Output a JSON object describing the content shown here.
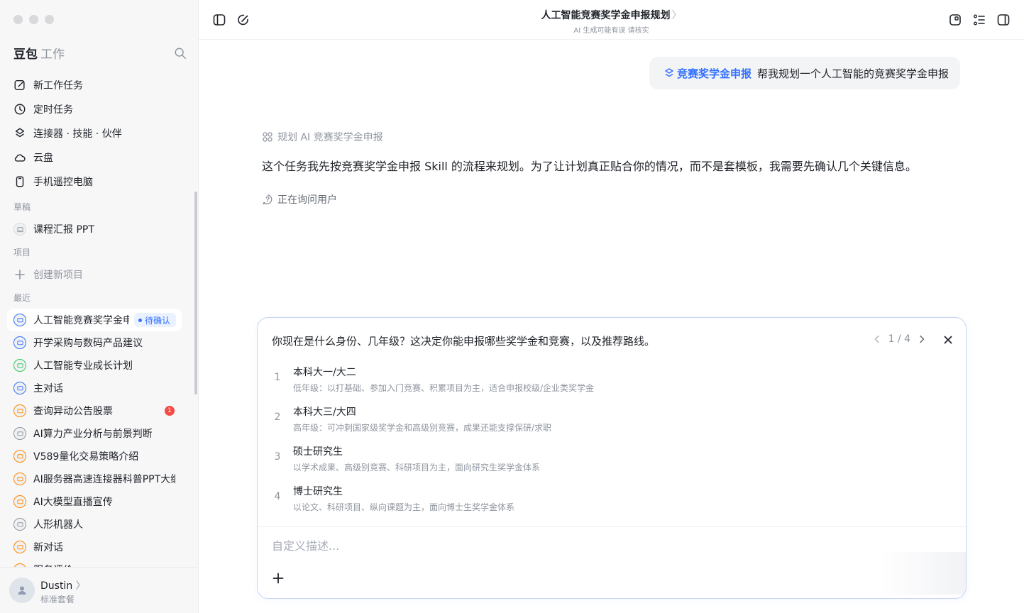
{
  "sidebar": {
    "brand": "豆包",
    "brand_sub": "工作",
    "nav": [
      {
        "label": "新工作任务",
        "icon": "edit-icon"
      },
      {
        "label": "定时任务",
        "icon": "clock-icon"
      },
      {
        "label": "连接器 · 技能 · 伙伴",
        "icon": "layers-icon"
      },
      {
        "label": "云盘",
        "icon": "cloud-icon"
      },
      {
        "label": "手机遥控电脑",
        "icon": "phone-icon"
      }
    ],
    "drafts_label": "草稿",
    "drafts": [
      {
        "label": "课程汇报 PPT"
      }
    ],
    "projects_label": "项目",
    "create_project": "创建新项目",
    "recent_label": "最近",
    "recent": [
      {
        "label": "人工智能竞赛奖学金申报规划",
        "badge": "待确认",
        "color": "#3370ff"
      },
      {
        "label": "开学采购与数码产品建议",
        "color": "#3370ff"
      },
      {
        "label": "人工智能专业成长计划",
        "color": "#34c759"
      },
      {
        "label": "主对话",
        "color": "#3370ff"
      },
      {
        "label": "查询异动公告股票",
        "count": "1",
        "color": "#ff8800"
      },
      {
        "label": "AI算力产业分析与前景判断",
        "color": "#8f959e"
      },
      {
        "label": "V589量化交易策略介绍",
        "color": "#ff8800"
      },
      {
        "label": "AI服务器高速连接器科普PPT大纲",
        "color": "#ff8800"
      },
      {
        "label": "AI大模型直播宣传",
        "color": "#ff8800"
      },
      {
        "label": "人形机器人",
        "color": "#8f959e"
      },
      {
        "label": "新对话",
        "color": "#ff8800"
      },
      {
        "label": "服务评价",
        "color": "#ff8800"
      }
    ],
    "user": {
      "name": "Dustin",
      "plan": "标准套餐"
    }
  },
  "header": {
    "title": "人工智能竞赛奖学金申报规划",
    "subtitle": "AI 生成可能有误 请核实"
  },
  "conversation": {
    "skill_tag": "竞赛奖学金申报",
    "user_message": "帮我规划一个人工智能的竞赛奖学金申报",
    "step_label": "规划 AI 竞赛奖学金申报",
    "answer": "这个任务我先按竞赛奖学金申报 Skill 的流程来规划。为了让计划真正贴合你的情况，而不是套模板，我需要先确认几个关键信息。",
    "status": "正在询问用户"
  },
  "question_card": {
    "question": "你现在是什么身份、几年级？这决定你能申报哪些奖学金和竞赛，以及推荐路线。",
    "pager": "1 / 4",
    "options": [
      {
        "num": "1",
        "title": "本科大一/大二",
        "desc": "低年级：以打基础、参加入门竞赛、积累项目为主，适合申报校级/企业类奖学金"
      },
      {
        "num": "2",
        "title": "本科大三/大四",
        "desc": "高年级：可冲刺国家级奖学金和高级别竞赛，成果还能支撑保研/求职"
      },
      {
        "num": "3",
        "title": "硕士研究生",
        "desc": "以学术成果、高级别竞赛、科研项目为主，面向研究生奖学金体系"
      },
      {
        "num": "4",
        "title": "博士研究生",
        "desc": "以论文、科研项目、纵向课题为主，面向博士生奖学金体系"
      }
    ],
    "custom_placeholder": "自定义描述..."
  }
}
